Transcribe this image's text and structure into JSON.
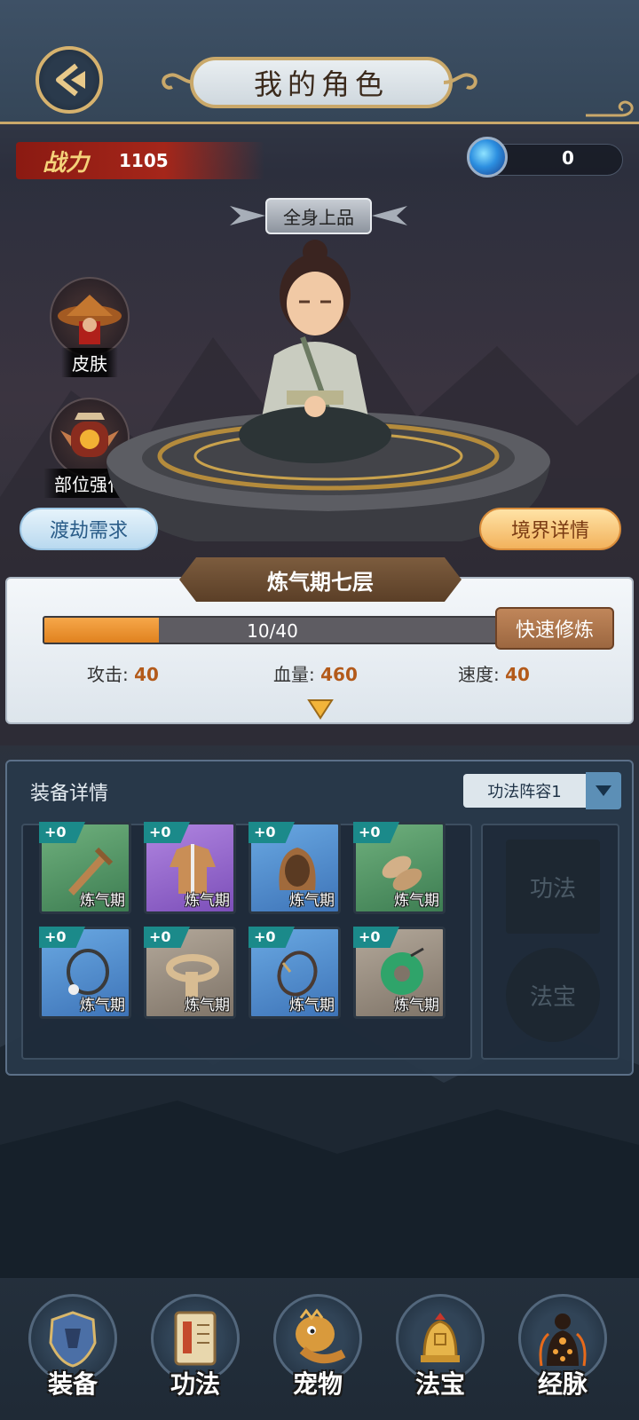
{
  "header": {
    "title": "我的角色"
  },
  "power": {
    "label": "战力",
    "value": "1105"
  },
  "currency": {
    "value": "0"
  },
  "quality_banner": "全身上品",
  "side_buttons": [
    {
      "label": "皮肤",
      "icon": "hat-character-icon"
    },
    {
      "label": "部位强化",
      "icon": "lantern-icon"
    }
  ],
  "pills": {
    "left": "渡劫需求",
    "right": "境界详情"
  },
  "realm": {
    "title": "炼气期七层",
    "progress_text": "10/40",
    "progress_fraction": 0.25,
    "quick_button": "快速修炼",
    "stats": [
      {
        "label": "攻击:",
        "value": "40"
      },
      {
        "label": "血量:",
        "value": "460"
      },
      {
        "label": "速度:",
        "value": "40"
      }
    ]
  },
  "equipment": {
    "title": "装备详情",
    "formation": "功法阵容1",
    "slots": [
      {
        "level": "+0",
        "name": "炼气期",
        "item": "sword-icon",
        "rarity": "green"
      },
      {
        "level": "+0",
        "name": "炼气期",
        "item": "robe-icon",
        "rarity": "purple"
      },
      {
        "level": "+0",
        "name": "炼气期",
        "item": "hood-icon",
        "rarity": "blue"
      },
      {
        "level": "+0",
        "name": "炼气期",
        "item": "shoes-icon",
        "rarity": "green"
      },
      {
        "level": "+0",
        "name": "炼气期",
        "item": "necklace-icon",
        "rarity": "blue"
      },
      {
        "level": "+0",
        "name": "炼气期",
        "item": "belt-icon",
        "rarity": "gray"
      },
      {
        "level": "+0",
        "name": "炼气期",
        "item": "bracelet-icon",
        "rarity": "blue"
      },
      {
        "level": "+0",
        "name": "炼气期",
        "item": "jade-ring-icon",
        "rarity": "gray"
      }
    ],
    "skill_slot": "功法",
    "treasure_slot": "法宝"
  },
  "nav": [
    {
      "label": "装备",
      "icon": "armor-icon"
    },
    {
      "label": "功法",
      "icon": "book-icon"
    },
    {
      "label": "宠物",
      "icon": "pet-icon"
    },
    {
      "label": "法宝",
      "icon": "bell-icon"
    },
    {
      "label": "经脉",
      "icon": "meridian-icon"
    }
  ],
  "colors": {
    "accent_gold": "#c9a86a",
    "progress": "#e0821f",
    "stat_value": "#b35a1a"
  }
}
